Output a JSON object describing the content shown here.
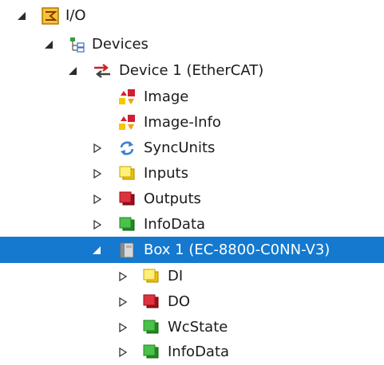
{
  "tree": {
    "io": {
      "label": "I/O",
      "expanded": true,
      "icon": "io-folder-icon"
    },
    "devices": {
      "label": "Devices",
      "expanded": true,
      "icon": "devices-tree-icon"
    },
    "device1": {
      "label": "Device 1 (EtherCAT)",
      "expanded": true,
      "icon": "ethercat-device-icon"
    },
    "image": {
      "label": "Image",
      "icon": "image-icon"
    },
    "image_info": {
      "label": "Image-Info",
      "icon": "image-info-icon"
    },
    "syncunits": {
      "label": "SyncUnits",
      "expanded": false,
      "icon": "sync-icon"
    },
    "inputs": {
      "label": "Inputs",
      "expanded": false,
      "icon": "inputs-icon"
    },
    "outputs": {
      "label": "Outputs",
      "expanded": false,
      "icon": "outputs-icon"
    },
    "infodata": {
      "label": "InfoData",
      "expanded": false,
      "icon": "infodata-icon"
    },
    "box1": {
      "label": "Box 1 (EC-8800-C0NN-V3)",
      "expanded": true,
      "selected": true,
      "icon": "box-module-icon"
    },
    "di": {
      "label": "DI",
      "expanded": false,
      "icon": "di-icon"
    },
    "do": {
      "label": "DO",
      "expanded": false,
      "icon": "do-icon"
    },
    "wcstate": {
      "label": "WcState",
      "expanded": false,
      "icon": "wcstate-icon"
    },
    "box_infodata": {
      "label": "InfoData",
      "expanded": false,
      "icon": "infodata-icon"
    }
  },
  "colors": {
    "selection": "#1479cf",
    "yellow": "#f2c200",
    "red": "#c8202a",
    "green": "#2aa52a"
  }
}
